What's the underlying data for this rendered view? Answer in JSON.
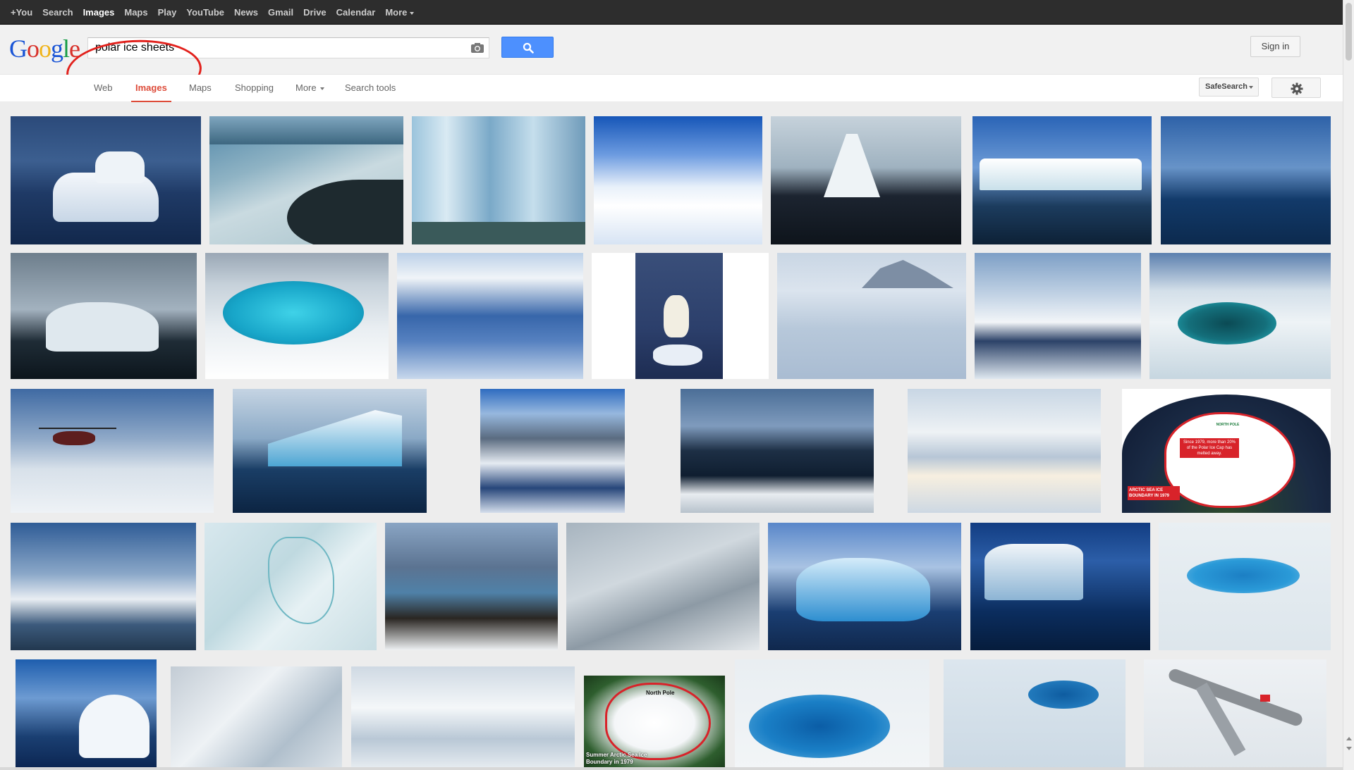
{
  "topbar": {
    "links": [
      "+You",
      "Search",
      "Images",
      "Maps",
      "Play",
      "YouTube",
      "News",
      "Gmail",
      "Drive",
      "Calendar",
      "More"
    ],
    "active": "Images"
  },
  "header": {
    "logo": [
      "G",
      "o",
      "o",
      "g",
      "l",
      "e"
    ],
    "query": "polar ice sheets",
    "sign_in": "Sign in"
  },
  "tabs": {
    "items": [
      "Web",
      "Images",
      "Maps",
      "Shopping",
      "More",
      "Search tools"
    ],
    "active": "Images",
    "safesearch": "SafeSearch"
  },
  "result_labels": {
    "arctic_map_top": "NORTH POLE",
    "arctic_map_note": "Since 1979, more than 20% of the Polar Ice Cap has melted away.",
    "arctic_map_bottom": "ARCTIC SEA ICE BOUNDARY IN 1979",
    "small_map_top": "North Pole",
    "small_map_bottom": "Summer Arctic Sea Ice Boundary in 1979"
  },
  "colors": {
    "accent": "#dd4b39",
    "search_button": "#4d90fe",
    "annotation": "#e2211c",
    "topbar": "#2d2d2d"
  }
}
